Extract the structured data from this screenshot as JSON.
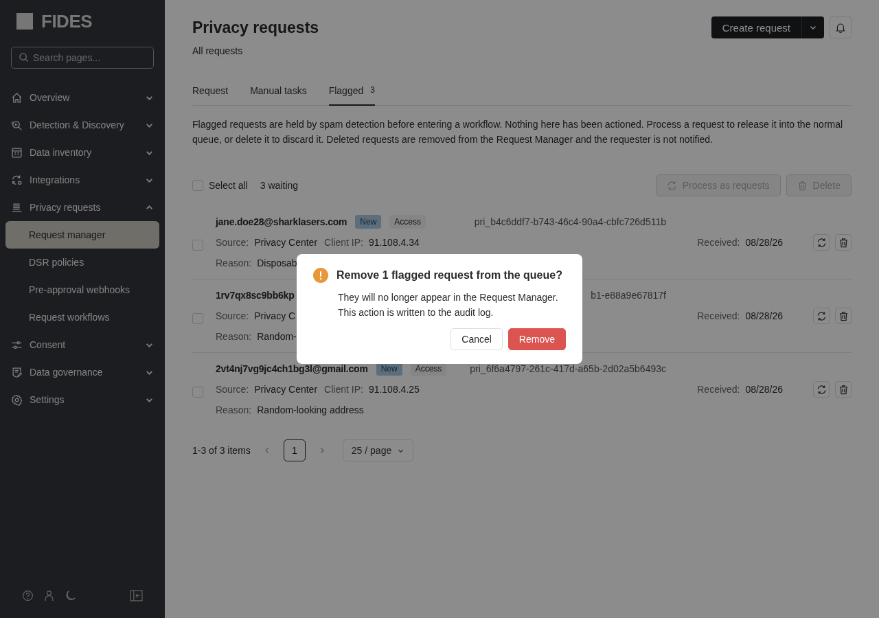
{
  "sidebar": {
    "logo": "FIDES",
    "search": {
      "placeholder": "Search pages..."
    },
    "items": [
      {
        "label": "Overview",
        "kind": "home",
        "expanded": false
      },
      {
        "label": "Detection & Discovery",
        "kind": "scan",
        "expanded": false
      },
      {
        "label": "Data inventory",
        "kind": "table",
        "expanded": false
      },
      {
        "label": "Integrations",
        "kind": "sync",
        "expanded": false
      },
      {
        "label": "Privacy requests",
        "kind": "list",
        "expanded": true,
        "children": [
          {
            "label": "Request manager",
            "selected": true
          },
          {
            "label": "DSR policies",
            "selected": false
          },
          {
            "label": "Pre-approval webhooks",
            "selected": false
          },
          {
            "label": "Request workflows",
            "selected": false
          }
        ]
      },
      {
        "label": "Consent",
        "kind": "sliders",
        "expanded": false
      },
      {
        "label": "Data governance",
        "kind": "document",
        "expanded": false
      },
      {
        "label": "Settings",
        "kind": "gear",
        "expanded": false
      }
    ]
  },
  "header": {
    "title": "Privacy requests",
    "subtitle": "All requests",
    "create_button": "Create request"
  },
  "tabs": [
    {
      "label": "Request",
      "selected": false
    },
    {
      "label": "Manual tasks",
      "selected": false
    },
    {
      "label": "Flagged",
      "badge": "3",
      "selected": true
    }
  ],
  "description": "Flagged requests are held by spam detection before entering a workflow. Nothing here has been actioned. Process a request to release it into the normal queue, or delete it to discard it. Deleted requests are removed from the Request Manager and the requester is not notified.",
  "toolbar": {
    "select_all": {
      "label": "Select all",
      "checked": false
    },
    "count": "3 waiting",
    "process_button": {
      "label": "Process as requests",
      "disabled": true
    },
    "delete_button": {
      "label": "Delete",
      "disabled": true
    }
  },
  "rows": [
    {
      "selected": false,
      "email": "jane.doe28@sharklasers.com",
      "tags": [
        {
          "label": "New",
          "kind": "status"
        },
        {
          "label": "Access",
          "kind": "type"
        }
      ],
      "request_id": "pri_b4c6ddf7-b743-46c4-90a4-cbfc726d511b",
      "details": [
        {
          "label": "Source:",
          "value": "Privacy Center"
        },
        {
          "label": "Client IP:",
          "value": "91.108.4.34"
        }
      ],
      "received": {
        "label": "Received:",
        "value": "08/28/26"
      },
      "reason": {
        "label": "Reason:",
        "value": "Disposab"
      }
    },
    {
      "selected": false,
      "email": "1rv7qx8sc9bb6kp",
      "tags": [],
      "request_id": "b1-e88a9e67817f",
      "details": [
        {
          "label": "Source:",
          "value": "Privacy C"
        }
      ],
      "received": {
        "label": "Received:",
        "value": "08/28/26"
      },
      "reason": {
        "label": "Reason:",
        "value": "Random-"
      }
    },
    {
      "selected": false,
      "email": "2vt4nj7vg9jc4ch1bg3l@gmail.com",
      "tags": [
        {
          "label": "New",
          "kind": "status"
        },
        {
          "label": "Access",
          "kind": "type"
        }
      ],
      "request_id": "pri_6f6a4797-261c-417d-a65b-2d02a5b6493c",
      "details": [
        {
          "label": "Source:",
          "value": "Privacy Center"
        },
        {
          "label": "Client IP:",
          "value": "91.108.4.25"
        }
      ],
      "received": {
        "label": "Received:",
        "value": "08/28/26"
      },
      "reason": {
        "label": "Reason:",
        "value": "Random-looking address"
      }
    }
  ],
  "pagination": {
    "summary": "1-3 of 3 items",
    "pages": [
      {
        "label": "1",
        "selected": true
      }
    ],
    "page_size": "25 / page"
  },
  "dialog": {
    "title": "Remove 1 flagged request from the queue?",
    "body": "They will no longer appear in the Request Manager. This action is written to the audit log.",
    "buttons": [
      {
        "label": "Cancel",
        "kind": "secondary"
      },
      {
        "label": "Remove",
        "kind": "danger"
      }
    ]
  }
}
